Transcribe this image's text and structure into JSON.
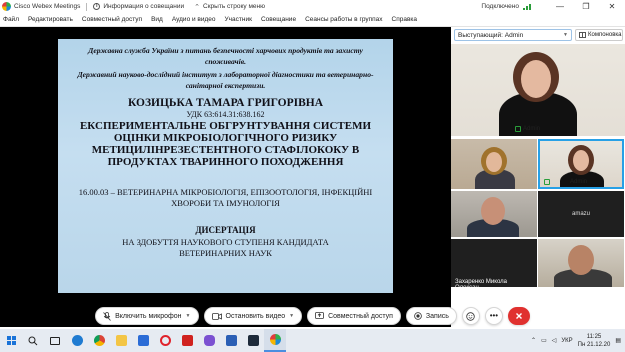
{
  "titlebar": {
    "app_title": "Cisco Webex Meetings",
    "info_label": "Информация о совещании",
    "hide_menu_label": "Скрыть строку меню",
    "status_label": "Подключено",
    "minimize": "—",
    "maximize": "❐",
    "close": "✕"
  },
  "menu": [
    "Файл",
    "Редактировать",
    "Совместный доступ",
    "Вид",
    "Аудио и видео",
    "Участник",
    "Совещание",
    "Сеансы работы в группах",
    "Справка"
  ],
  "slide": {
    "org_line1": "Державна служба України з питань безпечності харчових продуктів та захисту споживачів.",
    "org_line2": "Державний науково-дослідний інститут з лабораторної діагностики та ветеринарно-санітарної експертизи.",
    "author": "КОЗИЦЬКА ТАМАРА ГРИГОРІВНА",
    "udk": "УДК 63:614.31:638.162",
    "title": "ЕКСПЕРИМЕНТАЛЬНЕ ОБГРУНТУВАННЯ СИСТЕМИ ОЦІНКИ МІКРОБІОЛОГІЧНОГО РИЗИКУ МЕТИЦИЛІНРЕЗЕСТЕНТНОГО СТАФІЛОКОКУ В ПРОДУКТАХ ТВАРИННОГО ПОХОДЖЕННЯ",
    "specialty": "16.00.03 – ВЕТЕРИНАРНА МІКРОБІОЛОГІЯ, ЕПІЗООТОЛОГІЯ, ІНФЕКЦІЙНІ ХВОРОБИ ТА ІМУНОЛОГІЯ",
    "dissertation": "ДИСЕРТАЦІЯ",
    "degree": "НА ЗДОБУТТЯ НАУКОВОГО СТУПЕНЯ КАНДИДАТА ВЕТЕРИНАРНИХ НАУК"
  },
  "controls": {
    "mic_label": "Включить микрофон",
    "video_label": "Остановить видео",
    "share_label": "Совместный доступ",
    "record_label": "Запись"
  },
  "panel": {
    "speaker_label": "Выступающий: Admin",
    "layout_label": "Компоновка",
    "main_name": "Admin",
    "self_name": "Admin",
    "tile_amazu": "amazu",
    "tile_zakharenko": "Захаренко Микола Олексан..."
  },
  "taskbar": {
    "lang": "УКР",
    "time": "11:25",
    "date": "Пн 21.12.20"
  },
  "colors": {
    "slide_bg": "#b9d6ea",
    "end_button": "#e0312f",
    "self_border": "#27a0e6",
    "accent": "#1a73d8"
  }
}
